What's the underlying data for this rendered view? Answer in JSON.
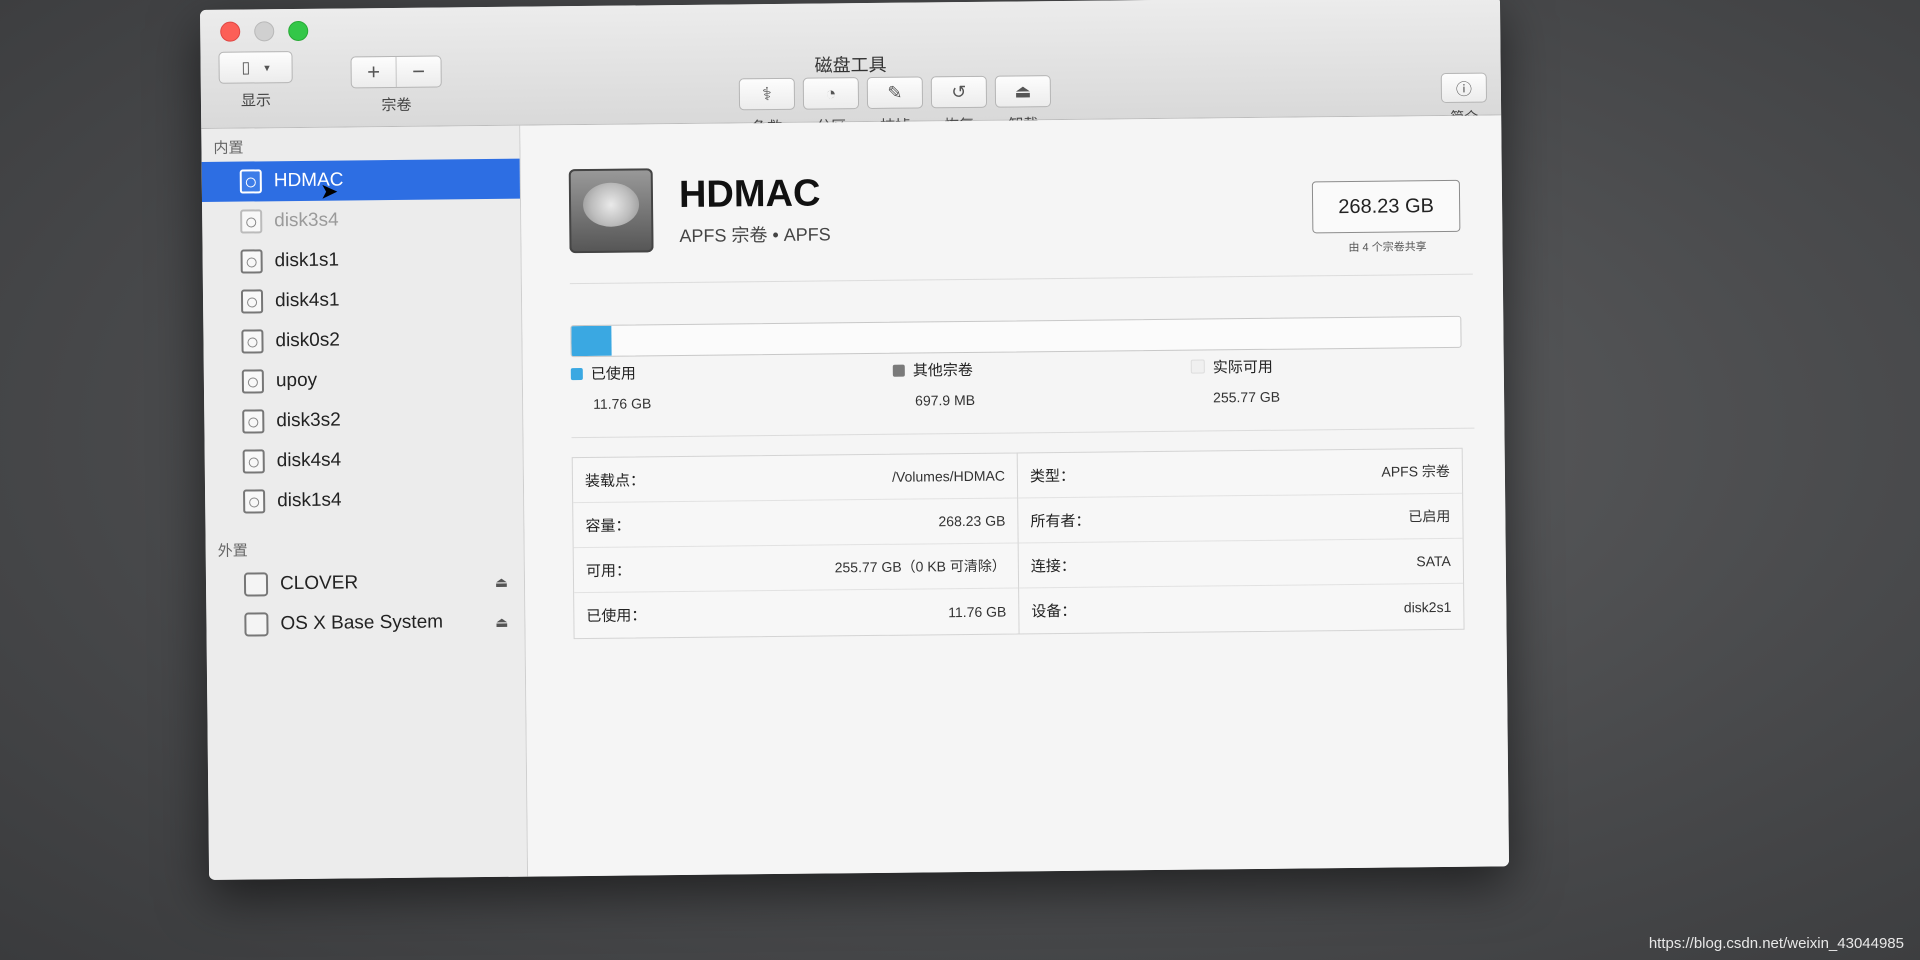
{
  "window": {
    "title": "磁盘工具"
  },
  "toolbar": {
    "view_label": "显示",
    "volume_label": "宗卷",
    "volume_add": "+",
    "volume_remove": "−",
    "first_aid": "急救",
    "partition": "分区",
    "erase": "抹掉",
    "restore": "恢复",
    "unmount": "卸载",
    "info": "简介"
  },
  "sidebar": {
    "internal_header": "内置",
    "internal": [
      {
        "label": "HDMAC",
        "selected": true
      },
      {
        "label": "disk3s4",
        "dim": true
      },
      {
        "label": "disk1s1"
      },
      {
        "label": "disk4s1"
      },
      {
        "label": "disk0s2"
      },
      {
        "label": "upoy"
      },
      {
        "label": "disk3s2"
      },
      {
        "label": "disk4s4"
      },
      {
        "label": "disk1s4"
      }
    ],
    "external_header": "外置",
    "external": [
      {
        "label": "CLOVER",
        "eject": "⏏"
      },
      {
        "label": "OS X Base System",
        "eject": "⏏"
      }
    ]
  },
  "volume": {
    "name": "HDMAC",
    "subtitle": "APFS 宗卷 • APFS",
    "size": "268.23 GB",
    "size_caption": "由 4 个宗卷共享",
    "usage_fraction": 0.045
  },
  "legend": [
    {
      "label": "已使用",
      "value": "11.76 GB",
      "color": "#3aa8e2"
    },
    {
      "label": "其他宗卷",
      "value": "697.9 MB",
      "color": "#7a7a7a"
    },
    {
      "label": "实际可用",
      "value": "255.77 GB",
      "color": "#f0f0f0"
    }
  ],
  "info": {
    "left": [
      {
        "key": "装载点：",
        "value": "/Volumes/HDMAC"
      },
      {
        "key": "容量：",
        "value": "268.23 GB"
      },
      {
        "key": "可用：",
        "value": "255.77 GB（0 KB 可清除）"
      },
      {
        "key": "已使用：",
        "value": "11.76 GB"
      }
    ],
    "right": [
      {
        "key": "类型：",
        "value": "APFS 宗卷"
      },
      {
        "key": "所有者：",
        "value": "已启用"
      },
      {
        "key": "连接：",
        "value": "SATA"
      },
      {
        "key": "设备：",
        "value": "disk2s1"
      }
    ]
  },
  "watermark": "https://blog.csdn.net/weixin_43044985"
}
